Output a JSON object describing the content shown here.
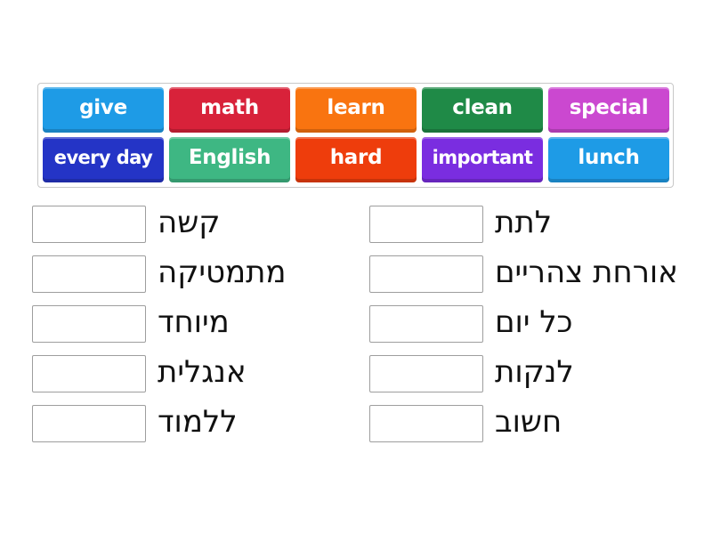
{
  "tiles": [
    {
      "label": "give",
      "color": "#1e9be6"
    },
    {
      "label": "math",
      "color": "#d8223a"
    },
    {
      "label": "learn",
      "color": "#f97410"
    },
    {
      "label": "clean",
      "color": "#1f8a47"
    },
    {
      "label": "special",
      "color": "#cb48d0"
    },
    {
      "label": "every day",
      "color": "#2434c6"
    },
    {
      "label": "English",
      "color": "#3eb783"
    },
    {
      "label": "hard",
      "color": "#ee3d0c"
    },
    {
      "label": "important",
      "color": "#7a2de0"
    },
    {
      "label": "lunch",
      "color": "#1e9be6"
    }
  ],
  "targets_left": [
    {
      "label": "קשה",
      "value": ""
    },
    {
      "label": "מתמטיקה",
      "value": ""
    },
    {
      "label": "מיוחד",
      "value": ""
    },
    {
      "label": "אנגלית",
      "value": ""
    },
    {
      "label": "ללמוד",
      "value": ""
    }
  ],
  "targets_right": [
    {
      "label": "לתת",
      "value": ""
    },
    {
      "label": "אורחת צהריים",
      "value": ""
    },
    {
      "label": "כל יום",
      "value": ""
    },
    {
      "label": "לנקות",
      "value": ""
    },
    {
      "label": "חשוב",
      "value": ""
    }
  ]
}
